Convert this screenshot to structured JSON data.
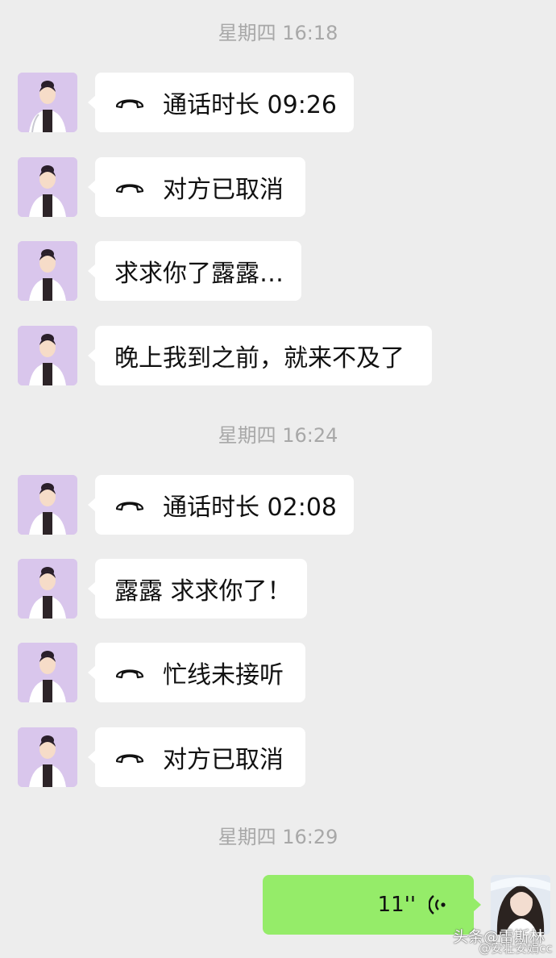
{
  "messages": [
    {
      "kind": "timestamp",
      "text": "星期四 16:18"
    },
    {
      "kind": "call",
      "text": "通话时长 09:26",
      "icon": "phone-hangup-icon"
    },
    {
      "kind": "call",
      "text": "对方已取消",
      "icon": "phone-hangup-icon"
    },
    {
      "kind": "text",
      "text": "求求你了露露…"
    },
    {
      "kind": "text",
      "text": "晚上我到之前，就来不及了"
    },
    {
      "kind": "timestamp",
      "text": "星期四 16:24"
    },
    {
      "kind": "call",
      "text": "通话时长 02:08",
      "icon": "phone-hangup-icon"
    },
    {
      "kind": "text",
      "text": "露露 求求你了！"
    },
    {
      "kind": "call",
      "text": "忙线未接听",
      "icon": "phone-hangup-icon"
    },
    {
      "kind": "call",
      "text": "对方已取消",
      "icon": "phone-hangup-icon"
    },
    {
      "kind": "timestamp",
      "text": "星期四 16:29"
    }
  ],
  "voice_message": {
    "duration": "11''",
    "icon": "voice-wave-icon"
  },
  "watermark": {
    "text": "头条@雷斯林",
    "sub": "@安壮安娟cc"
  },
  "colors": {
    "background": "#ededed",
    "received_bubble": "#ffffff",
    "sent_bubble": "#95ec69",
    "timestamp": "#a8a8a8"
  }
}
